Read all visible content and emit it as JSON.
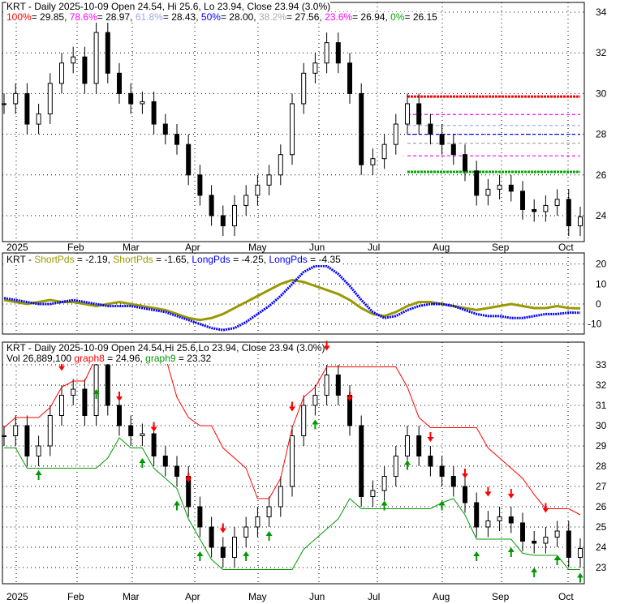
{
  "header": {
    "ticker": "KRT",
    "title": "KRT - Daily 2025-10-09 Open 24.54, Hi 25.6, Lo 23.94, Close 23.94 (3.0%)",
    "title3": "KRT - Daily 2025-10-09 Open 24.54,Hi 25.6,Lo 23.94, Close 23.94 (3.0%)",
    "fib": [
      {
        "label": "100%",
        "value": "= 29.85, ",
        "color": "#ff0000"
      },
      {
        "label": "78.6%",
        "value": "= 28.97, ",
        "color": "#ff00ff"
      },
      {
        "label": "61.8%",
        "value": "= 28.43, ",
        "color": "#99aadd"
      },
      {
        "label": "50%",
        "value": "= 28.00, ",
        "color": "#0000ff"
      },
      {
        "label": "38.2%",
        "value": "= 27.56, ",
        "color": "#aaaaaa"
      },
      {
        "label": "23.6%",
        "value": "= 26.94, ",
        "color": "#ff00ff"
      },
      {
        "label": "0%",
        "value": "= 26.15",
        "color": "#00aa00"
      }
    ],
    "osc": {
      "prefix": "KRT - ",
      "s1": "ShortPds",
      "v1": " = -2.19, ",
      "s2": "ShortPds",
      "v2": " = -1.65, ",
      "l1": "LongPds",
      "v3": " = -4.25, ",
      "l2": "LongPds",
      "v4": " = -4.35"
    },
    "vol": {
      "text": "Vol 26,889,100 ",
      "g8": "graph8",
      "v8": " = 24.96, ",
      "g9": "graph9",
      "v9": " = 23.32"
    }
  },
  "chart_data": {
    "type": "line",
    "x_labels": [
      "2025",
      "Feb",
      "Mar",
      "Apr",
      "May",
      "Jun",
      "Jul",
      "Aug",
      "Sep",
      "Oct"
    ],
    "close_weekly": [
      29.5,
      30,
      28.5,
      29,
      30.5,
      31.5,
      31.8,
      30.5,
      33,
      31,
      30,
      29.5,
      29.6,
      28.5,
      28,
      27.5,
      26,
      25,
      24,
      23.5,
      24.5,
      25,
      25.5,
      26,
      27,
      29.5,
      31,
      31.5,
      32.5,
      31.5,
      30,
      26.5,
      26.8,
      27.5,
      28.5,
      29.5,
      28.5,
      28,
      27.5,
      27,
      26.2,
      25,
      25.3,
      25.5,
      25.2,
      24.3,
      24.2,
      24.5,
      24.8,
      23.5,
      23.94
    ],
    "short_pds": [
      2,
      1,
      0,
      1,
      2,
      1,
      1,
      0,
      -1,
      0,
      1,
      0,
      -1,
      -2,
      -3,
      -5,
      -7,
      -8,
      -7,
      -5,
      -2,
      1,
      4,
      7,
      10,
      12,
      11,
      9,
      7,
      5,
      2,
      -2,
      -5,
      -6,
      -4,
      -1,
      1,
      1,
      0,
      -1,
      -2,
      -3,
      -2,
      -1,
      0,
      -1,
      -2,
      -2,
      -1,
      -2,
      -2.19
    ],
    "long_pds": [
      3,
      2,
      1,
      0,
      0,
      1,
      2,
      1,
      0,
      -1,
      -1,
      -1,
      -2,
      -3,
      -4,
      -6,
      -8,
      -10,
      -12,
      -13,
      -12,
      -9,
      -5,
      -1,
      4,
      10,
      16,
      19,
      19,
      15,
      9,
      2,
      -4,
      -7,
      -6,
      -3,
      -1,
      0,
      0,
      -1,
      -3,
      -5,
      -6,
      -6,
      -7,
      -7,
      -6,
      -5,
      -5,
      -4.3,
      -4.35
    ],
    "fib_levels": [
      29.85,
      28.97,
      28.43,
      28.0,
      27.56,
      26.94,
      26.15
    ],
    "panel1_yticks": [
      24,
      26,
      28,
      30,
      32,
      34
    ],
    "panel2_yticks": [
      -10,
      0,
      10,
      20
    ],
    "panel3_yticks": [
      23,
      24,
      25,
      26,
      27,
      28,
      29,
      30,
      31,
      32,
      33
    ],
    "graph8": 24.96,
    "graph9": 23.32,
    "buy_arrows": [
      3,
      8,
      12,
      15,
      17,
      21,
      23,
      27,
      33,
      35,
      38,
      41,
      44,
      46,
      48,
      50
    ],
    "sell_arrows": [
      5,
      6,
      10,
      13,
      16,
      19,
      25,
      28,
      30,
      37,
      40,
      42,
      44,
      47
    ]
  }
}
